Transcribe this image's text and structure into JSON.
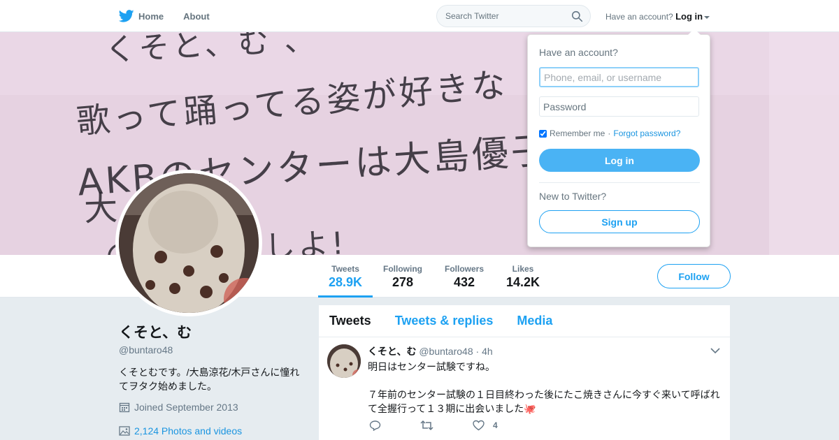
{
  "nav": {
    "home_label": "Home",
    "about_label": "About",
    "search_placeholder": "Search Twitter",
    "have_account": "Have an account?",
    "login_label": "Log in"
  },
  "banner": {
    "lines": [
      "くそと、む 、",
      "歌って踊ってる姿が好きな",
      "AKBのセンターは大島優子",
      "大        花だ!!",
      "             の    大島涼      しよ!"
    ]
  },
  "stats": [
    {
      "label": "Tweets",
      "value": "28.9K"
    },
    {
      "label": "Following",
      "value": "278"
    },
    {
      "label": "Followers",
      "value": "432"
    },
    {
      "label": "Likes",
      "value": "14.2K"
    }
  ],
  "follow_label": "Follow",
  "profile": {
    "name": "くそと、む",
    "handle": "@buntaro48",
    "bio": "くそとむです。/大島涼花/木戸さんに憧れてヲタク始めました。",
    "joined": "Joined September 2013",
    "photos": "2,124 Photos and videos"
  },
  "timeline": {
    "tabs": [
      "Tweets",
      "Tweets & replies",
      "Media"
    ]
  },
  "tweet": {
    "name": "くそと、む",
    "handle": "@buntaro48",
    "separator": "·",
    "time": "4h",
    "line1": "明日はセンター試験ですね。",
    "line2": "７年前のセンター試験の１日目終わった後にたこ焼きさんに今すぐ来いて呼ばれて全握行って１３期に出会いました🐙",
    "likes": "4"
  },
  "login": {
    "title": "Have an account?",
    "username_placeholder": "Phone, email, or username",
    "password_placeholder": "Password",
    "remember": "Remember me",
    "dot": "·",
    "forgot": "Forgot password?",
    "button": "Log in",
    "new_text": "New to Twitter?",
    "signup": "Sign up"
  },
  "colors": {
    "accent": "#1da1f2",
    "login_button": "#4ab3f4",
    "page_bg": "#e6ecf0"
  }
}
